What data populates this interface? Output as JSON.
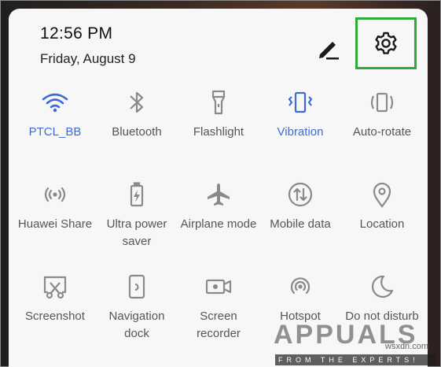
{
  "status": {
    "time": "12:56 PM",
    "date": "Friday, August 9"
  },
  "accent": "#3d6bd6",
  "highlight": "#2eaa3a",
  "tiles": [
    {
      "label": "PTCL_BB",
      "icon": "wifi-icon",
      "active": true
    },
    {
      "label": "Bluetooth",
      "icon": "bluetooth-icon",
      "active": false
    },
    {
      "label": "Flashlight",
      "icon": "flashlight-icon",
      "active": false
    },
    {
      "label": "Vibration",
      "icon": "vibration-icon",
      "active": true
    },
    {
      "label": "Auto-rotate",
      "icon": "auto-rotate-icon",
      "active": false
    },
    {
      "label": "Huawei Share",
      "icon": "huawei-share-icon",
      "active": false
    },
    {
      "label": "Ultra power",
      "label2": "saver",
      "icon": "battery-saver-icon",
      "active": false
    },
    {
      "label": "Airplane mode",
      "icon": "airplane-icon",
      "active": false
    },
    {
      "label": "Mobile data",
      "icon": "mobile-data-icon",
      "active": false
    },
    {
      "label": "Location",
      "icon": "location-icon",
      "active": false
    },
    {
      "label": "Screenshot",
      "icon": "screenshot-icon",
      "active": false
    },
    {
      "label": "Navigation",
      "label2": "dock",
      "icon": "navigation-dock-icon",
      "active": false
    },
    {
      "label": "Screen",
      "label2": "recorder",
      "icon": "screen-recorder-icon",
      "active": false
    },
    {
      "label": "Hotspot",
      "icon": "hotspot-icon",
      "active": false
    },
    {
      "label": "Do not disturb",
      "icon": "do-not-disturb-icon",
      "active": false
    }
  ],
  "watermark": {
    "brand": "APPUALS",
    "tagline": "FROM THE EXPERTS!",
    "site": "wsxdn.com"
  }
}
